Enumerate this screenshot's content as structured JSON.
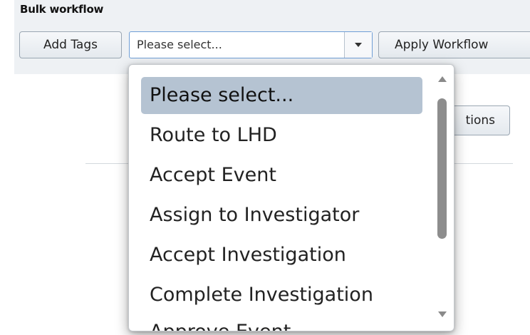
{
  "bulk_workflow": {
    "title": "Bulk workflow",
    "add_tags_label": "Add Tags",
    "select_value": "Please select...",
    "apply_label": "Apply Workflow"
  },
  "background": {
    "options_button_label": "tions"
  },
  "dropdown": {
    "options": [
      {
        "label": "Please select...",
        "selected": true
      },
      {
        "label": "Route to LHD",
        "selected": false
      },
      {
        "label": "Accept Event",
        "selected": false
      },
      {
        "label": "Assign to Investigator",
        "selected": false
      },
      {
        "label": "Accept Investigation",
        "selected": false
      },
      {
        "label": "Complete Investigation",
        "selected": false
      },
      {
        "label": "Approve Event",
        "selected": false
      }
    ]
  },
  "colors": {
    "panel_background": "#eef1f4",
    "selected_option_background": "#b5c3d2",
    "select_border": "#6f9ed6"
  }
}
